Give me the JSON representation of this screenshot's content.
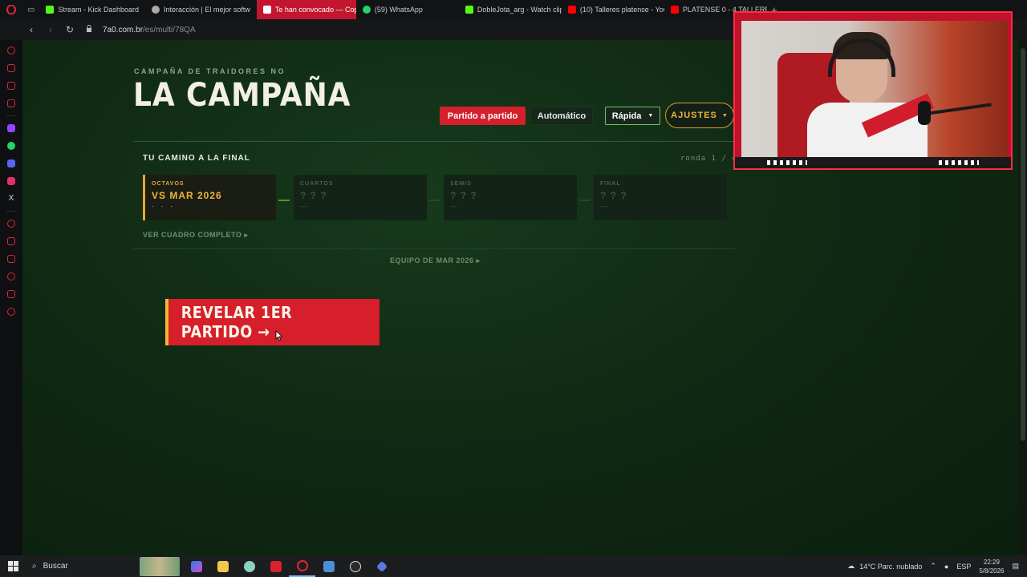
{
  "browser": {
    "tabs": [
      {
        "label": "Stream - Kick Dashboard",
        "icon": "kick-icon",
        "color": "#53fc18"
      },
      {
        "label": "Interacción | El mejor softw",
        "icon": "generic-icon",
        "color": "#aaaaaa"
      },
      {
        "label": "Te han convocado — Copa",
        "icon": "site-icon",
        "color": "#ffffff",
        "active": true
      },
      {
        "label": "(59) WhatsApp",
        "icon": "whatsapp-icon",
        "color": "#25d366"
      },
      {
        "label": "DobleJota_arg - Watch clip",
        "icon": "kick-icon",
        "color": "#53fc18"
      },
      {
        "label": "(10) Talleres platense - You",
        "icon": "youtube-icon",
        "color": "#ff0000"
      },
      {
        "label": "PLATENSE 0 - 4 TALLERES",
        "icon": "youtube-icon",
        "color": "#ff0000"
      }
    ],
    "url_host": "7a0.com.br",
    "url_path": "/es/multi/78QA"
  },
  "page": {
    "kicker": "CAMPAÑA DE TRAIDORES NO",
    "title": "LA CAMPAÑA",
    "controls": {
      "partido": "Partido a partido",
      "automatico": "Automático",
      "rapida": "Rápida",
      "ajustes": "AJUSTES"
    },
    "camino_title": "TU CAMINO A LA FINAL",
    "ronda": "ronda 1 / 4",
    "stages": [
      {
        "label": "OCTAVOS",
        "opponent": "VS MAR 2026",
        "sub": "· · ·",
        "active": true
      },
      {
        "label": "CUARTOS",
        "opponent": "? ? ?",
        "sub": "—",
        "active": false
      },
      {
        "label": "SEMIS",
        "opponent": "? ? ?",
        "sub": "—",
        "active": false
      },
      {
        "label": "FINAL",
        "opponent": "? ? ?",
        "sub": "—",
        "active": false
      }
    ],
    "ver_cuadro": "VER CUADRO COMPLETO ▸",
    "equipo_link": "EQUIPO DE MAR 2026 ▸",
    "reveal_button": "REVELAR 1ER PARTIDO →"
  },
  "taskbar": {
    "search_placeholder": "Buscar",
    "weather": "14°C  Parc. nublado",
    "lang": "ESP",
    "time": "22:29",
    "date": "5/8/2026"
  }
}
